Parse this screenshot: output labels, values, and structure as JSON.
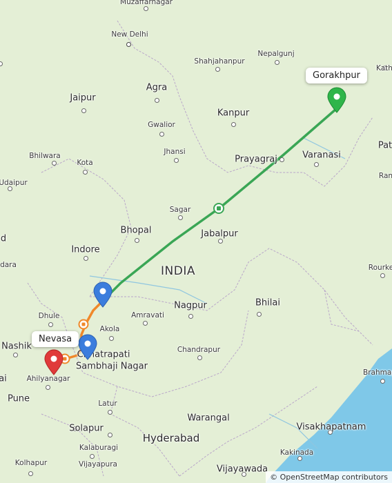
{
  "map": {
    "country_label": "INDIA",
    "attribution": "© OpenStreetMap contributors",
    "colors": {
      "land": "#e4efd6",
      "sea": "#7fc8e8",
      "route_main": "#3aa655",
      "route_secondary": "#f0882a",
      "pin_start": "#2fb54a",
      "pin_via": "#3b7ddd",
      "pin_end": "#e03a3a"
    },
    "pins": {
      "start_label": "Gorakhpur",
      "end_label": "Nevasa"
    },
    "cities": [
      {
        "id": "muzaffarnagar",
        "name": "Muzaffarnagar"
      },
      {
        "id": "new-delhi",
        "name": "New Delhi"
      },
      {
        "id": "shahjahanpur",
        "name": "Shahjahanpur"
      },
      {
        "id": "nepalgunj",
        "name": "Nepalgunj"
      },
      {
        "id": "agra",
        "name": "Agra"
      },
      {
        "id": "jaipur",
        "name": "Jaipur"
      },
      {
        "id": "kanpur",
        "name": "Kanpur"
      },
      {
        "id": "gwalior",
        "name": "Gwalior"
      },
      {
        "id": "varanasi",
        "name": "Varanasi"
      },
      {
        "id": "prayagraj",
        "name": "Prayagraj"
      },
      {
        "id": "jhansi",
        "name": "Jhansi"
      },
      {
        "id": "bhilwara",
        "name": "Bhilwara"
      },
      {
        "id": "kota",
        "name": "Kota"
      },
      {
        "id": "udaipur",
        "name": "Udaipur"
      },
      {
        "id": "sagar",
        "name": "Sagar"
      },
      {
        "id": "bhopal",
        "name": "Bhopal"
      },
      {
        "id": "jabalpur",
        "name": "Jabalpur"
      },
      {
        "id": "indore",
        "name": "Indore"
      },
      {
        "id": "nagpur",
        "name": "Nagpur"
      },
      {
        "id": "bhilai",
        "name": "Bhilai"
      },
      {
        "id": "rourkela",
        "name": "Rourke"
      },
      {
        "id": "dhule",
        "name": "Dhule"
      },
      {
        "id": "amravati",
        "name": "Amravati"
      },
      {
        "id": "akola",
        "name": "Akola"
      },
      {
        "id": "nashik",
        "name": "Nashik"
      },
      {
        "id": "chhatrapati",
        "name": "Chhatrapati"
      },
      {
        "id": "sambhaji",
        "name": "Sambhaji Nagar"
      },
      {
        "id": "chandrapur",
        "name": "Chandrapur"
      },
      {
        "id": "ahilyanagar",
        "name": "Ahilyanagar"
      },
      {
        "id": "brahmapur",
        "name": "Brahmap"
      },
      {
        "id": "pune",
        "name": "Pune"
      },
      {
        "id": "latur",
        "name": "Latur"
      },
      {
        "id": "solapur",
        "name": "Solapur"
      },
      {
        "id": "warangal",
        "name": "Warangal"
      },
      {
        "id": "hyderabad",
        "name": "Hyderabad"
      },
      {
        "id": "visakhapatnam",
        "name": "Visakhapatnam"
      },
      {
        "id": "kalaburagi",
        "name": "Kalaburagi"
      },
      {
        "id": "vijayapura",
        "name": "Vijayapura"
      },
      {
        "id": "kolhapur",
        "name": "Kolhapur"
      },
      {
        "id": "kakinada",
        "name": "Kakinada"
      },
      {
        "id": "vijayawada",
        "name": "Vijayawada"
      },
      {
        "id": "kathmandu-partial",
        "name": "Kath"
      },
      {
        "id": "patna-partial",
        "name": "Pat"
      },
      {
        "id": "ranchi-partial",
        "name": "Ran"
      },
      {
        "id": "ahmedabad-partial",
        "name": "d"
      },
      {
        "id": "vadodara-partial",
        "name": "dara"
      },
      {
        "id": "mumbai-partial",
        "name": "ai"
      }
    ]
  }
}
